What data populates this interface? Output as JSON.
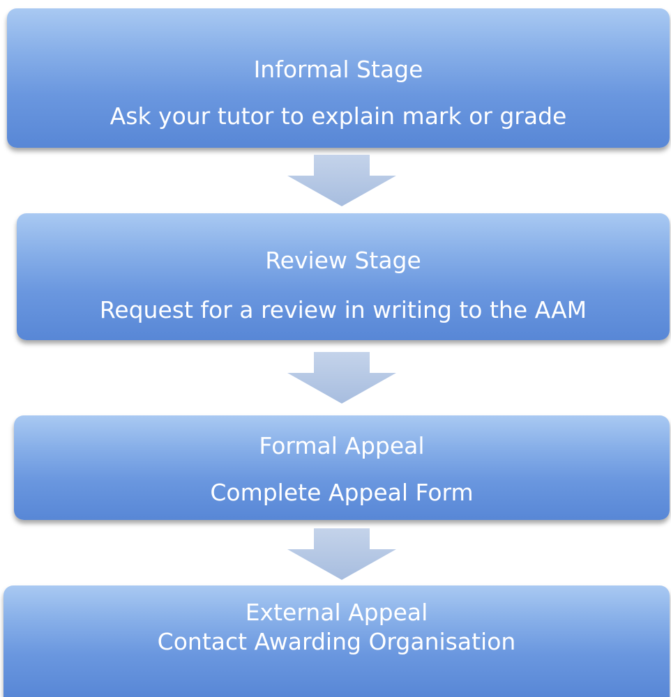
{
  "steps": [
    {
      "title": "Informal Stage",
      "description": "Ask your tutor to explain mark or grade"
    },
    {
      "title": "Review Stage",
      "description": "Request for a review in writing to the AAM"
    },
    {
      "title": "Formal Appeal",
      "description": "Complete Appeal Form"
    },
    {
      "title": "External Appeal",
      "description": "Contact Awarding Organisation"
    }
  ],
  "colors": {
    "box_top": "#a9c9f2",
    "box_bottom": "#5887d6",
    "arrow": "#b3c6e4",
    "text": "#ffffff"
  }
}
